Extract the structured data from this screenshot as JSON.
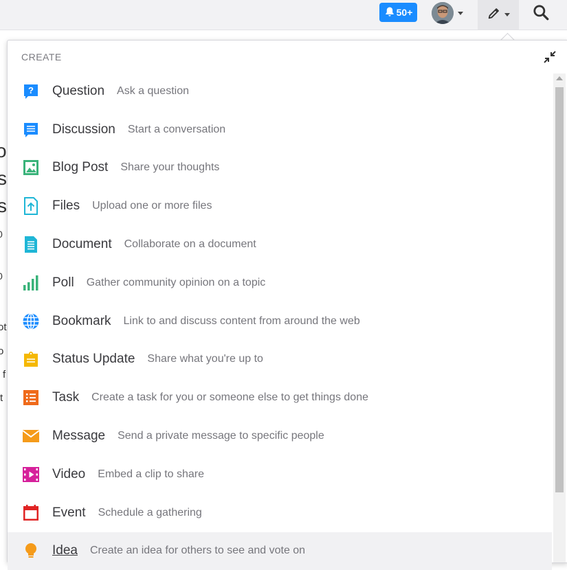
{
  "topbar": {
    "notifications_count": "50+",
    "avatar_alt": "user avatar",
    "icons": [
      "bell-icon",
      "chevron-down-icon",
      "pencil-icon",
      "search-icon"
    ]
  },
  "background_text": [
    "o",
    "s",
    "s",
    "0",
    "0",
    "ot",
    "o",
    "f",
    "t"
  ],
  "menu": {
    "header": "CREATE",
    "items": [
      {
        "label": "Question",
        "desc": "Ask a question",
        "icon": "question-icon",
        "color": "#1a8cff"
      },
      {
        "label": "Discussion",
        "desc": "Start a conversation",
        "icon": "discussion-icon",
        "color": "#1a8cff"
      },
      {
        "label": "Blog Post",
        "desc": "Share your thoughts",
        "icon": "blog-post-icon",
        "color": "#3ab37a"
      },
      {
        "label": "Files",
        "desc": "Upload one or more files",
        "icon": "file-upload-icon",
        "color": "#1fb6d6"
      },
      {
        "label": "Document",
        "desc": "Collaborate on a document",
        "icon": "document-icon",
        "color": "#1fb6d6"
      },
      {
        "label": "Poll",
        "desc": "Gather community opinion on a topic",
        "icon": "poll-icon",
        "color": "#3ab37a"
      },
      {
        "label": "Bookmark",
        "desc": "Link to and discuss content from around the web",
        "icon": "globe-icon",
        "color": "#1a8cff"
      },
      {
        "label": "Status Update",
        "desc": "Share what you're up to",
        "icon": "status-update-icon",
        "color": "#f5b800"
      },
      {
        "label": "Task",
        "desc": "Create a task for you or someone else to get things done",
        "icon": "task-icon",
        "color": "#ef6a1a"
      },
      {
        "label": "Message",
        "desc": "Send a private message to specific people",
        "icon": "message-icon",
        "color": "#f59b1a"
      },
      {
        "label": "Video",
        "desc": "Embed a clip to share",
        "icon": "video-icon",
        "color": "#d6219b"
      },
      {
        "label": "Event",
        "desc": "Schedule a gathering",
        "icon": "calendar-icon",
        "color": "#e02424"
      },
      {
        "label": "Idea",
        "desc": "Create an idea for others to see and vote on",
        "icon": "lightbulb-icon",
        "color": "#f59b1a"
      }
    ]
  }
}
